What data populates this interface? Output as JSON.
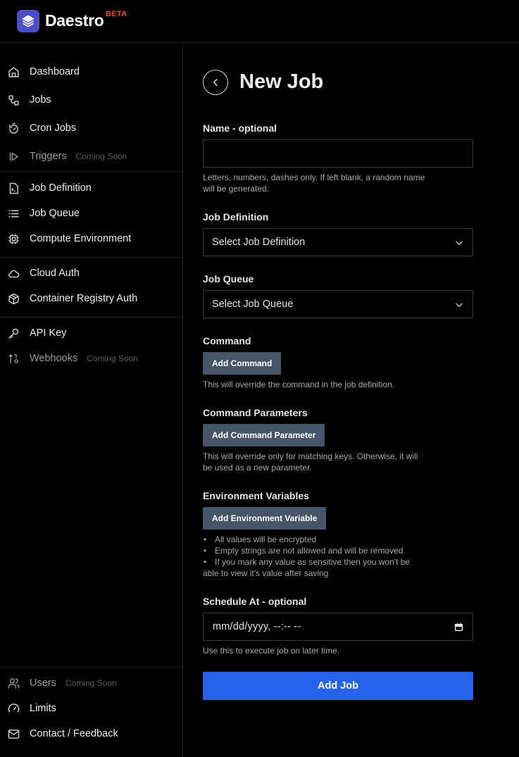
{
  "brand": {
    "name": "Daestro",
    "badge": "BETA",
    "color": "#4b4ec7",
    "badge_color": "#ef4a23"
  },
  "sidebar": {
    "primary": [
      {
        "label": "Dashboard",
        "icon": "home-icon"
      },
      {
        "label": "Jobs",
        "icon": "workflow-icon"
      },
      {
        "label": "Cron Jobs",
        "icon": "timer-icon"
      },
      {
        "label": "Triggers",
        "icon": "play-bar-icon",
        "badge": "Coming Soon"
      }
    ],
    "definitions": [
      {
        "label": "Job Definition",
        "icon": "file-terminal-icon"
      },
      {
        "label": "Job Queue",
        "icon": "list-icon"
      },
      {
        "label": "Compute Environment",
        "icon": "cpu-icon"
      }
    ],
    "auth": [
      {
        "label": "Cloud Auth",
        "icon": "cloud-icon"
      },
      {
        "label": "Container Registry Auth",
        "icon": "box-icon"
      }
    ],
    "integrations": [
      {
        "label": "API Key",
        "icon": "key-icon"
      },
      {
        "label": "Webhooks",
        "icon": "webhook-icon",
        "badge": "Coming Soon"
      }
    ],
    "footer": [
      {
        "label": "Users",
        "icon": "users-icon",
        "badge": "Coming Soon"
      },
      {
        "label": "Limits",
        "icon": "gauge-icon"
      },
      {
        "label": "Contact / Feedback",
        "icon": "mail-icon"
      }
    ]
  },
  "page": {
    "title": "New Job"
  },
  "form": {
    "name": {
      "label": "Name - optional",
      "value": "",
      "help": "Letters, numbers, dashes only. If left blank, a random name will be generated."
    },
    "job_definition": {
      "label": "Job Definition",
      "value": "Select Job Definition"
    },
    "job_queue": {
      "label": "Job Queue",
      "value": "Select Job Queue"
    },
    "command": {
      "label": "Command",
      "button": "Add Command",
      "help": "This will override the command in the job definition."
    },
    "command_parameters": {
      "label": "Command Parameters",
      "button": "Add Command Parameter",
      "help": "This will override only for matching keys. Otherwise, it will be used as a new parameter."
    },
    "env_vars": {
      "label": "Environment Variables",
      "button": "Add Environment Variable",
      "notes": [
        "All values will be encrypted",
        "Empty strings are not allowed and will be removed",
        "If you mark any value as sensitive then you won't be able to view it's value after saving"
      ]
    },
    "schedule": {
      "label": "Schedule At - optional",
      "value": "mm/dd/yyyy, --:-- --",
      "help": "Use this to execute job on later time."
    },
    "submit": "Add Job"
  },
  "colors": {
    "primary_button": "#2563eb",
    "secondary_button": "#475569"
  }
}
